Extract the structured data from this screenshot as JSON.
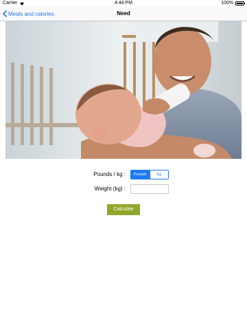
{
  "status_bar": {
    "carrier": "Carrier",
    "time": "4:44 PM",
    "battery": "100%"
  },
  "nav": {
    "back_label": "Meals and calories",
    "title": "Need"
  },
  "form": {
    "unit_label": "Pounds / kg :",
    "unit_options": [
      "Pounds",
      "Kg"
    ],
    "unit_selected": "Pounds",
    "weight_label": "Weight (kg) :",
    "weight_value": "",
    "calculate_label": "Calculate"
  },
  "colors": {
    "accent": "#1a7bf0",
    "button_green": "#8fa82a"
  }
}
